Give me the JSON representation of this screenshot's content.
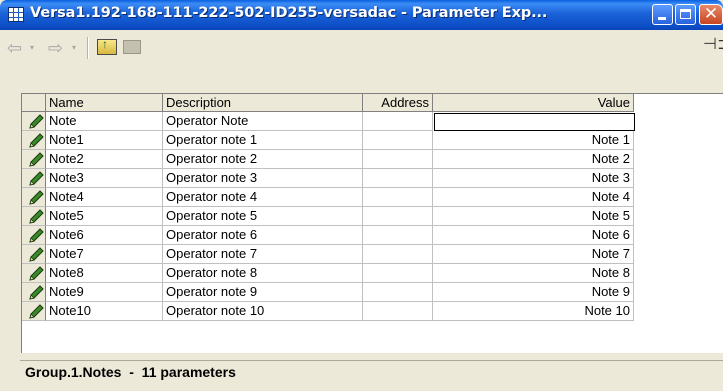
{
  "window": {
    "title": "Versa1.192-168-111-222-502-ID255-versadac - Parameter Exp...",
    "close_glyph": "✕"
  },
  "toolbar": {
    "back_glyph": "⇦",
    "forward_glyph": "⇨",
    "dropdown_glyph": "▾",
    "pin_glyph": "⊣⊐",
    "icons": [
      "back-arrow-icon",
      "forward-arrow-icon",
      "folder-up-icon",
      "folder-icon",
      "pin-icon"
    ]
  },
  "table": {
    "columns": [
      "Name",
      "Description",
      "Address",
      "Value"
    ],
    "rows": [
      {
        "name": "Note",
        "description": "Operator Note",
        "address": "",
        "value": ""
      },
      {
        "name": "Note1",
        "description": "Operator note 1",
        "address": "",
        "value": "Note 1"
      },
      {
        "name": "Note2",
        "description": "Operator note 2",
        "address": "",
        "value": "Note 2"
      },
      {
        "name": "Note3",
        "description": "Operator note 3",
        "address": "",
        "value": "Note 3"
      },
      {
        "name": "Note4",
        "description": "Operator note 4",
        "address": "",
        "value": "Note 4"
      },
      {
        "name": "Note5",
        "description": "Operator note 5",
        "address": "",
        "value": "Note 5"
      },
      {
        "name": "Note6",
        "description": "Operator note 6",
        "address": "",
        "value": "Note 6"
      },
      {
        "name": "Note7",
        "description": "Operator note 7",
        "address": "",
        "value": "Note 7"
      },
      {
        "name": "Note8",
        "description": "Operator note 8",
        "address": "",
        "value": "Note 8"
      },
      {
        "name": "Note9",
        "description": "Operator note 9",
        "address": "",
        "value": "Note 9"
      },
      {
        "name": "Note10",
        "description": "Operator note 10",
        "address": "",
        "value": "Note 10"
      }
    ]
  },
  "status": {
    "text": "Group.1.Notes  -  11 parameters"
  },
  "colors": {
    "titlebar": "#0a5fe0",
    "window_bg": "#ece9d8",
    "pencil": "#3a8a2a"
  }
}
